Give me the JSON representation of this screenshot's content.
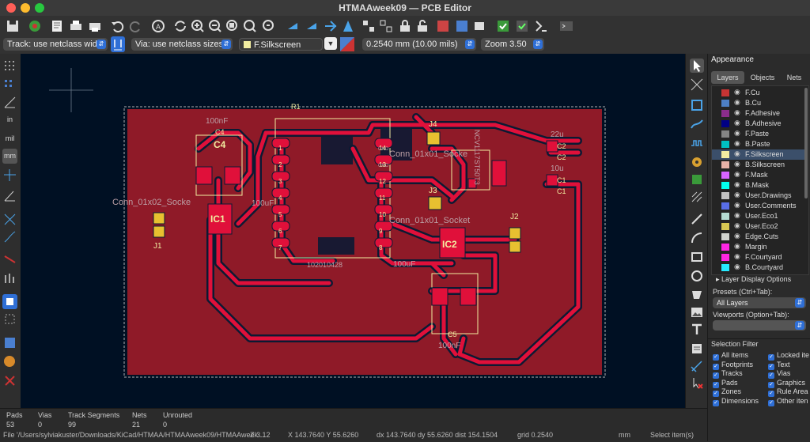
{
  "window": {
    "title": "HTMAAweek09 — PCB Editor"
  },
  "toolbar2": {
    "track_width": "Track: use netclass width",
    "via_size": "Via: use netclass sizes",
    "active_layer": "F.Silkscreen",
    "grid": "0.2540 mm (10.00 mils)",
    "zoom": "Zoom 3.50"
  },
  "left_toolbar": {
    "in_label": "in",
    "mil_label": "mil",
    "mm_label": "mm"
  },
  "board": {
    "components": {
      "c4_value": "100nF",
      "c4_ref": "C4",
      "c4_ref2": "C4",
      "conn_j1_label": "Conn_01x02_Socke",
      "j1_ref": "J1",
      "ic1_ref": "IC1",
      "ic1_value": "100uF",
      "u1_value": "102010428",
      "pins_left": [
        "1",
        "2",
        "3",
        "4",
        "5",
        "6",
        "7"
      ],
      "pins_right": [
        "14",
        "13",
        "12",
        "11",
        "10",
        "9",
        "8"
      ],
      "pin_net_14": "GND",
      "pin_net_13": "GND",
      "j4_ref": "J4",
      "conn_j4_label": "Conn_01x01_Socke",
      "j3_ref": "J3",
      "conn_j3_label": "Conn_01x01_Socket",
      "j2_ref": "J2",
      "ic2_ref": "IC2",
      "ic2_value": "100uF",
      "c5_ref": "C5",
      "c5_value": "100nF",
      "c2_value": "22u",
      "c2_ref": "C2",
      "c2_ref2": "C2",
      "c1_value": "10u",
      "c1_ref": "C1",
      "c1_ref2": "C1",
      "r1_ref": "R1",
      "led_label": "NCV1117ST50T3"
    }
  },
  "appearance": {
    "title": "Appearance",
    "tabs": [
      "Layers",
      "Objects",
      "Nets"
    ],
    "layers": [
      {
        "name": "F.Cu",
        "color": "#c83434"
      },
      {
        "name": "B.Cu",
        "color": "#4d7fc4"
      },
      {
        "name": "F.Adhesive",
        "color": "#8b2d8b"
      },
      {
        "name": "B.Adhesive",
        "color": "#000084"
      },
      {
        "name": "F.Paste",
        "color": "#848484"
      },
      {
        "name": "B.Paste",
        "color": "#00c2c2"
      },
      {
        "name": "F.Silkscreen",
        "color": "#f2eda1"
      },
      {
        "name": "B.Silkscreen",
        "color": "#e8b2a7"
      },
      {
        "name": "F.Mask",
        "color": "#d864ff"
      },
      {
        "name": "B.Mask",
        "color": "#02ffee"
      },
      {
        "name": "User.Drawings",
        "color": "#c2c2c2"
      },
      {
        "name": "User.Comments",
        "color": "#596ee8"
      },
      {
        "name": "User.Eco1",
        "color": "#b4dbd2"
      },
      {
        "name": "User.Eco2",
        "color": "#d8c852"
      },
      {
        "name": "Edge.Cuts",
        "color": "#d0d2cd"
      },
      {
        "name": "Margin",
        "color": "#ff26e2"
      },
      {
        "name": "F.Courtyard",
        "color": "#ff26e2"
      },
      {
        "name": "B.Courtyard",
        "color": "#26e9ff"
      }
    ],
    "layer_display_options": "Layer Display Options",
    "presets_label": "Presets (Ctrl+Tab):",
    "presets_value": "All Layers",
    "viewports_label": "Viewports (Option+Tab):",
    "viewports_value": ""
  },
  "selection_filter": {
    "title": "Selection Filter",
    "items": [
      "All items",
      "Locked ite",
      "Footprints",
      "Text",
      "Tracks",
      "Vias",
      "Pads",
      "Graphics",
      "Zones",
      "Rule Area",
      "Dimensions",
      "Other iten"
    ]
  },
  "status": {
    "headers": [
      "Pads",
      "Vias",
      "Track Segments",
      "Nets",
      "Unrouted"
    ],
    "values": [
      "53",
      "0",
      "99",
      "21",
      "0"
    ],
    "file": "File '/Users/sylviakuster/Downloads/KiCad/HTMAA/HTMAAweek09/HTMAAweek...",
    "zoom": "Z 3.12",
    "xy": "X 143.7640  Y 55.6260",
    "dxy": "dx 143.7640  dy 55.6260  dist 154.1504",
    "grid": "grid 0.2540",
    "units": "mm",
    "mode": "Select item(s)"
  },
  "colors": {
    "copper": "#c8102e",
    "track": "#e0103a",
    "board_fill": "#8f1a28",
    "silk": "#f2eda1",
    "canvas": "#001023",
    "accent": "#2f6fd6"
  }
}
